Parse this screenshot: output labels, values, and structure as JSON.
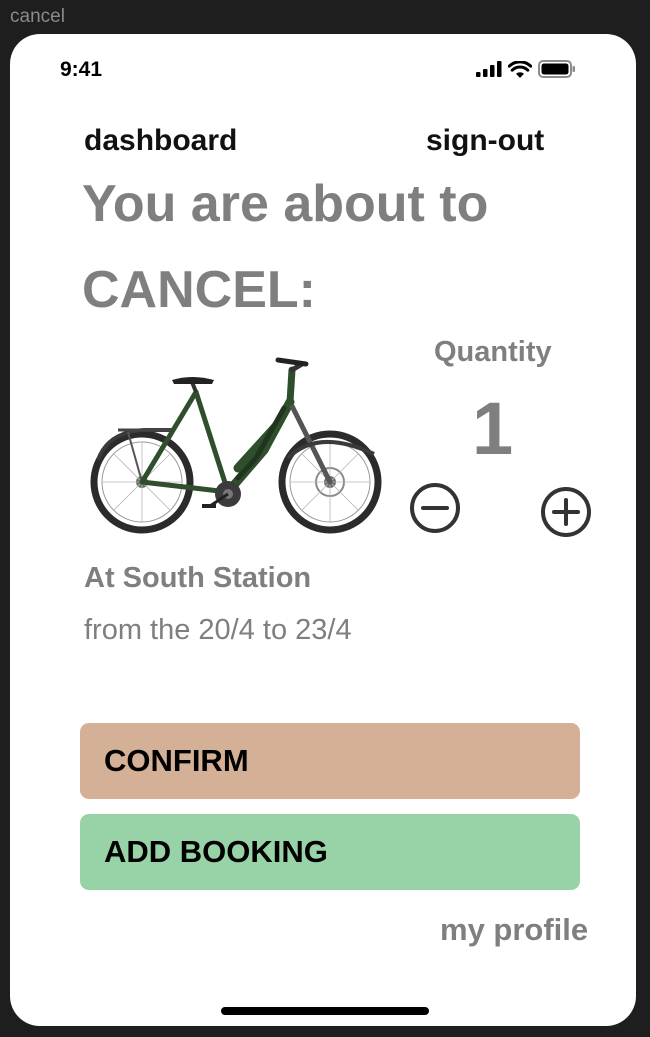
{
  "frame_label": "cancel",
  "status_bar": {
    "time": "9:41",
    "icons": [
      "signal-icon",
      "wifi-icon",
      "battery-icon"
    ]
  },
  "nav": {
    "dashboard": "dashboard",
    "sign_out": "sign-out"
  },
  "headline": {
    "line1": "You are about to",
    "line2": "CANCEL:"
  },
  "bike_image": "e-bike-image",
  "quantity": {
    "label": "Quantity",
    "value": "1",
    "decrement_icon": "minus-circle-icon",
    "increment_icon": "plus-circle-icon"
  },
  "booking": {
    "location": "At South Station",
    "dates": "from the 20/4 to 23/4"
  },
  "buttons": {
    "confirm": "CONFIRM",
    "add_booking": "ADD BOOKING"
  },
  "footer": {
    "my_profile": "my profile"
  },
  "colors": {
    "background": "#1e1e1e",
    "screen": "#ffffff",
    "muted_text": "#7f7f7f",
    "confirm_button": "#d4b097",
    "add_booking_button": "#98d3a7",
    "bike_frame": "#2f4f2c"
  }
}
